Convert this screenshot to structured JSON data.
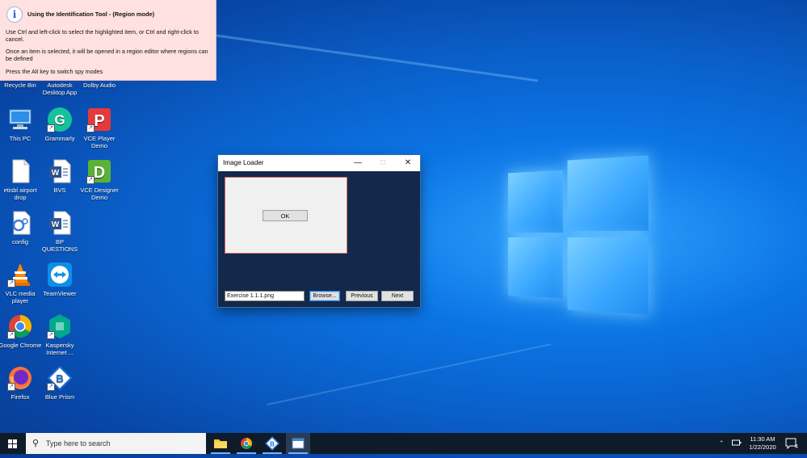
{
  "tooltip": {
    "title": "Using the Identification Tool - (Region mode)",
    "line1": "Use Ctrl and left-click to select the highlighted item, or Ctrl and right-click to cancel.",
    "line2": "Once an item is selected, it will be opened in a region editor where regions can be defined",
    "line3": "Press the Alt key to switch spy modes"
  },
  "desktop_icons": [
    {
      "label": "Recycle Bin",
      "icon": "recycle-bin-icon"
    },
    {
      "label": "Autodesk Desktop App",
      "icon": "autodesk-icon"
    },
    {
      "label": "Dolby Audio",
      "icon": "dolby-icon"
    },
    {
      "label": "This PC",
      "icon": "computer-icon"
    },
    {
      "label": "Grammarly",
      "icon": "grammarly-icon"
    },
    {
      "label": "VCE Player Demo",
      "icon": "vce-player-icon"
    },
    {
      "label": "etisbl airport drop",
      "icon": "document-icon"
    },
    {
      "label": "BVS",
      "icon": "word-doc-icon"
    },
    {
      "label": "VCE Designer Demo",
      "icon": "vce-designer-icon"
    },
    {
      "label": "config",
      "icon": "config-file-icon"
    },
    {
      "label": "BP QUESTIONS",
      "icon": "word-doc-icon"
    },
    {
      "label": "VLC media player",
      "icon": "vlc-icon"
    },
    {
      "label": "TeamViewer",
      "icon": "teamviewer-icon"
    },
    {
      "label": "Google Chrome",
      "icon": "chrome-icon"
    },
    {
      "label": "Kaspersky Internet ...",
      "icon": "kaspersky-icon"
    },
    {
      "label": "Firefox",
      "icon": "firefox-icon"
    },
    {
      "label": "Blue Prism",
      "icon": "blue-prism-icon"
    }
  ],
  "window": {
    "title": "Image Loader",
    "ok_label": "OK",
    "filename_value": "Exercise 1.1.1.png",
    "browse_label": "Browse...",
    "previous_label": "Previous",
    "next_label": "Next"
  },
  "taskbar": {
    "search_placeholder": "Type here to search",
    "time": "11:30 AM",
    "date": "1/22/2020",
    "notification_count": "4"
  },
  "colors": {
    "tooltip_bg": "#ffe1e1",
    "window_bg": "#13284a",
    "taskbar_bg": "#101b2a",
    "desktop_blue": "#0b74e4"
  }
}
